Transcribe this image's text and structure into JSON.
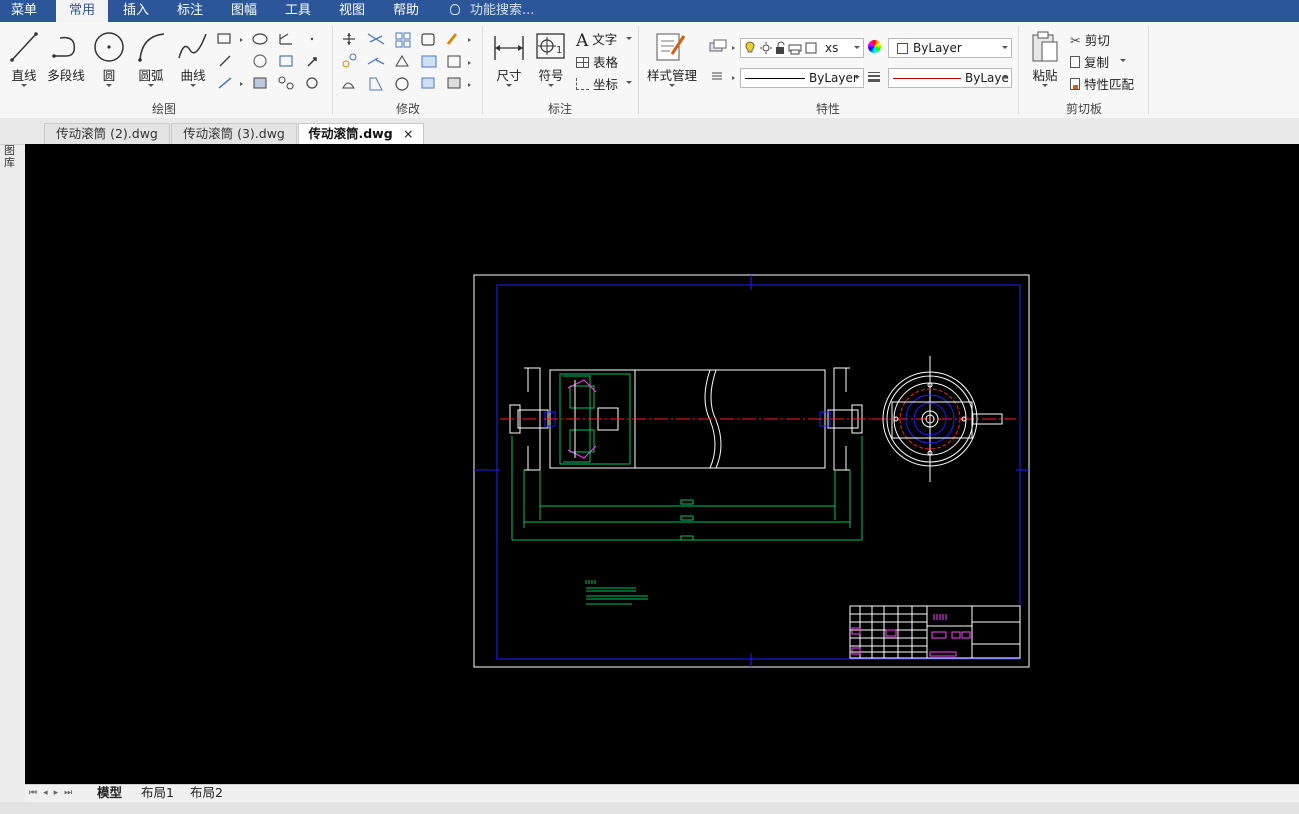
{
  "menubar": {
    "items": [
      "菜单",
      "常用",
      "插入",
      "标注",
      "图幅",
      "工具",
      "视图",
      "帮助"
    ],
    "active": "常用",
    "search_placeholder": "功能搜索..."
  },
  "ribbon": {
    "draw": {
      "label": "绘图",
      "line": "直线",
      "polyline": "多段线",
      "circle": "圆",
      "arc": "圆弧",
      "curve": "曲线"
    },
    "modify": {
      "label": "修改"
    },
    "annotate": {
      "label": "标注",
      "dimension": "尺寸",
      "symbol": "符号",
      "text": "文字",
      "table": "表格",
      "coordinate": "坐标"
    },
    "properties": {
      "label": "特性",
      "style_manager": "样式管理",
      "layer_name": "xs",
      "color": "ByLayer",
      "linetype": "ByLayer",
      "lineweight": "ByLaye"
    },
    "clipboard": {
      "label": "剪切板",
      "paste": "粘贴",
      "cut": "剪切",
      "copy": "复制",
      "match": "特性匹配"
    }
  },
  "doc_tabs": [
    "传动滚筒 (2).dwg",
    "传动滚筒 (3).dwg",
    "传动滚筒.dwg"
  ],
  "active_doc": "传动滚筒.dwg",
  "sidebar_label": "图库",
  "layout_tabs": [
    "模型",
    "布局1",
    "布局2"
  ],
  "active_layout": "模型",
  "colors": {
    "accent": "#2b579a",
    "canvas": "#000000",
    "frame_blue": "#2020ff",
    "center_red": "#ff2020",
    "dim_green": "#00c060"
  }
}
